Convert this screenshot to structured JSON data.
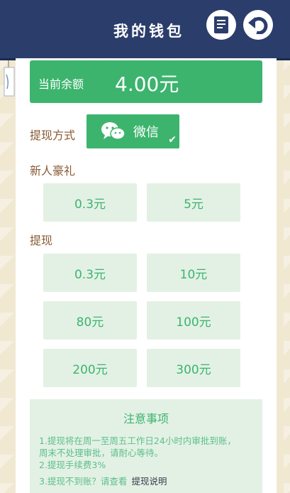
{
  "header": {
    "title": "我的钱包"
  },
  "balance": {
    "label": "当前余额",
    "value": "4.00元"
  },
  "withdraw_method": {
    "label": "提现方式",
    "option": "微信",
    "checkmark": "✔"
  },
  "newcomer": {
    "label": "新人豪礼",
    "amounts": [
      "0.3元",
      "5元"
    ]
  },
  "withdraw": {
    "label": "提现",
    "amounts": [
      "0.3元",
      "10元",
      "80元",
      "100元",
      "200元",
      "300元"
    ]
  },
  "notice": {
    "title": "注意事项",
    "line1": "1.提现将在周一至周五工作日24小时内审批到账，",
    "line2": "周末不处理审批，请耐心等待。",
    "line3": "2.提现手续费3%",
    "line4": "3.提现不到账？请查看",
    "link": "提现说明"
  },
  "colors": {
    "header": "#2b3d6b",
    "accent_green": "#3cb46e",
    "button_light": "#e3f1e5",
    "label_brown": "#8a5a34"
  },
  "icons": {
    "records": "document-list-icon",
    "back": "back-arrow-icon",
    "wechat": "wechat-icon"
  }
}
